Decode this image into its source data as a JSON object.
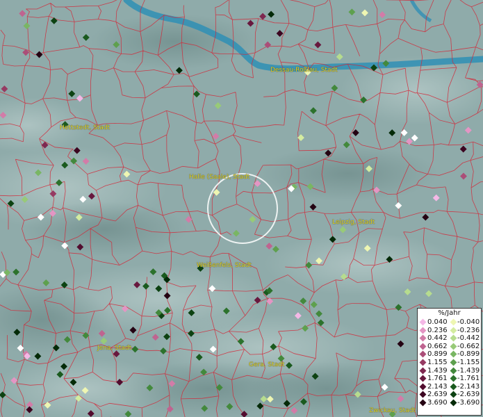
{
  "cities": [
    {
      "name": "Dessau-Roßlau, Stadt"
    },
    {
      "name": "Hettstedt, Stadt"
    },
    {
      "name": "Halle (Saale), Stadt"
    },
    {
      "name": "Leipzig, Stadt"
    },
    {
      "name": "Weißenfels, Stadt"
    },
    {
      "name": "Jena, Stadt"
    },
    {
      "name": "Gera, Stadt"
    },
    {
      "name": "Zwickau, Stadt"
    }
  ],
  "legend": {
    "title": "%/Jahr",
    "rows": [
      {
        "pos": "0.040",
        "neg": "-0.040",
        "pos_color": "#f4b8e6",
        "neg_color": "#eef6b2"
      },
      {
        "pos": "0.236",
        "neg": "-0.236",
        "pos_color": "#e495c4",
        "neg_color": "#d4eca0"
      },
      {
        "pos": "0.442",
        "neg": "-0.442",
        "pos_color": "#d27ca8",
        "neg_color": "#b6dc8e"
      },
      {
        "pos": "0.662",
        "neg": "-0.662",
        "pos_color": "#bf6490",
        "neg_color": "#98ca78"
      },
      {
        "pos": "0.899",
        "neg": "-0.899",
        "pos_color": "#ab4e78",
        "neg_color": "#79b663"
      },
      {
        "pos": "1.155",
        "neg": "-1.155",
        "pos_color": "#963a62",
        "neg_color": "#5ea04e"
      },
      {
        "pos": "1.439",
        "neg": "-1.439",
        "pos_color": "#7e2850",
        "neg_color": "#43893c"
      },
      {
        "pos": "1.761",
        "neg": "-1.761",
        "pos_color": "#68183e",
        "neg_color": "#2c722c"
      },
      {
        "pos": "2.143",
        "neg": "-2.143",
        "pos_color": "#520c2e",
        "neg_color": "#1a5a1e"
      },
      {
        "pos": "2.639",
        "neg": "-2.639",
        "pos_color": "#3c0520",
        "neg_color": "#0d4212"
      },
      {
        "pos": "3.690",
        "neg": "-3.690",
        "pos_color": "#240212",
        "neg_color": "#042a08"
      }
    ]
  }
}
